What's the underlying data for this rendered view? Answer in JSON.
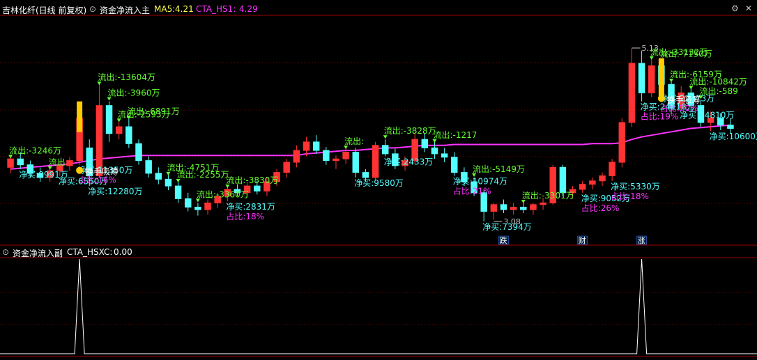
{
  "header": {
    "stock": "吉林化纤(日线 前复权)",
    "indicator": "资金净流入主",
    "ma5_label": "MA5:",
    "ma5_value": "4.21",
    "hs1_label": "CTA_HS1:",
    "hs1_value": "4.29"
  },
  "sub_header": {
    "indicator": "资金净流入副",
    "label": "CTA_HSXC:",
    "value": "0.00"
  },
  "colors": {
    "up": "#ff3333",
    "down": "#54ffff",
    "ma": "#ff33ff",
    "outflow": "#66ff33",
    "inflow": "#54ffff",
    "ratio": "#ff33ff",
    "signal": "#ffcc00",
    "panel_border": "#a00000",
    "header_yellow": "#ffff54"
  },
  "chart_data": [
    {
      "type": "candlestick",
      "title": "资金净流入主",
      "ylim": [
        2.9,
        5.5
      ],
      "price_marks": [
        {
          "label": "5.13",
          "index": 63,
          "value": 5.13
        },
        {
          "label": "3.08",
          "index": 49,
          "value": 3.08
        }
      ],
      "candles": [
        [
          3.72,
          3.85,
          3.65,
          3.82
        ],
        [
          3.82,
          3.9,
          3.7,
          3.75
        ],
        [
          3.75,
          3.8,
          3.6,
          3.65
        ],
        [
          3.65,
          3.72,
          3.55,
          3.6
        ],
        [
          3.6,
          3.7,
          3.55,
          3.68
        ],
        [
          3.68,
          3.78,
          3.62,
          3.74
        ],
        [
          3.74,
          3.84,
          3.68,
          3.8
        ],
        [
          3.8,
          4.45,
          3.75,
          4.3
        ],
        [
          3.95,
          4.05,
          3.5,
          3.62
        ],
        [
          3.62,
          4.7,
          3.6,
          4.45
        ],
        [
          4.45,
          4.5,
          4.02,
          4.12
        ],
        [
          4.12,
          4.28,
          4.05,
          4.2
        ],
        [
          4.2,
          4.3,
          3.95,
          4.0
        ],
        [
          4.0,
          4.05,
          3.75,
          3.8
        ],
        [
          3.8,
          3.85,
          3.6,
          3.65
        ],
        [
          3.65,
          3.72,
          3.52,
          3.58
        ],
        [
          3.58,
          3.65,
          3.45,
          3.5
        ],
        [
          3.5,
          3.55,
          3.3,
          3.35
        ],
        [
          3.35,
          3.42,
          3.2,
          3.25
        ],
        [
          3.25,
          3.3,
          3.15,
          3.22
        ],
        [
          3.22,
          3.34,
          3.16,
          3.3
        ],
        [
          3.3,
          3.42,
          3.24,
          3.38
        ],
        [
          3.38,
          3.5,
          3.32,
          3.46
        ],
        [
          3.46,
          3.52,
          3.38,
          3.42
        ],
        [
          3.42,
          3.55,
          3.36,
          3.5
        ],
        [
          3.5,
          3.56,
          3.4,
          3.44
        ],
        [
          3.44,
          3.6,
          3.38,
          3.55
        ],
        [
          3.55,
          3.7,
          3.5,
          3.66
        ],
        [
          3.66,
          3.82,
          3.6,
          3.78
        ],
        [
          3.78,
          3.98,
          3.72,
          3.92
        ],
        [
          3.92,
          4.08,
          3.85,
          4.02
        ],
        [
          4.02,
          4.1,
          3.88,
          3.92
        ],
        [
          3.92,
          3.96,
          3.75,
          3.8
        ],
        [
          3.8,
          3.86,
          3.7,
          3.82
        ],
        [
          3.82,
          3.96,
          3.76,
          3.9
        ],
        [
          3.9,
          3.95,
          3.6,
          3.66
        ],
        [
          3.66,
          3.7,
          3.55,
          3.6
        ],
        [
          3.6,
          4.02,
          3.56,
          3.98
        ],
        [
          3.98,
          4.05,
          3.85,
          3.88
        ],
        [
          3.88,
          3.94,
          3.7,
          3.74
        ],
        [
          3.74,
          3.85,
          3.68,
          3.8
        ],
        [
          3.8,
          4.12,
          3.76,
          4.05
        ],
        [
          4.05,
          4.12,
          3.9,
          3.95
        ],
        [
          3.95,
          4.02,
          3.82,
          3.88
        ],
        [
          3.88,
          3.95,
          3.78,
          3.84
        ],
        [
          3.84,
          3.9,
          3.62,
          3.66
        ],
        [
          3.66,
          3.72,
          3.5,
          3.55
        ],
        [
          3.55,
          3.6,
          3.38,
          3.42
        ],
        [
          3.42,
          3.46,
          3.08,
          3.2
        ],
        [
          3.2,
          3.3,
          3.1,
          3.28
        ],
        [
          3.28,
          3.34,
          3.18,
          3.22
        ],
        [
          3.22,
          3.3,
          3.16,
          3.25
        ],
        [
          3.25,
          3.32,
          3.18,
          3.22
        ],
        [
          3.22,
          3.3,
          3.16,
          3.28
        ],
        [
          3.28,
          3.36,
          3.22,
          3.3
        ],
        [
          3.3,
          3.75,
          3.28,
          3.72
        ],
        [
          3.72,
          3.75,
          3.38,
          3.42
        ],
        [
          3.42,
          3.5,
          3.36,
          3.46
        ],
        [
          3.46,
          3.56,
          3.42,
          3.52
        ],
        [
          3.52,
          3.6,
          3.46,
          3.56
        ],
        [
          3.56,
          3.66,
          3.5,
          3.62
        ],
        [
          3.62,
          3.82,
          3.56,
          3.78
        ],
        [
          3.78,
          4.3,
          3.72,
          4.25
        ],
        [
          4.25,
          5.13,
          4.2,
          4.95
        ],
        [
          4.95,
          5.1,
          4.5,
          4.6
        ],
        [
          4.6,
          5.0,
          4.55,
          4.92
        ],
        [
          4.92,
          4.96,
          4.6,
          4.7
        ],
        [
          4.7,
          4.75,
          4.35,
          4.42
        ],
        [
          4.42,
          4.68,
          4.4,
          4.6
        ],
        [
          4.6,
          4.65,
          4.38,
          4.45
        ],
        [
          4.45,
          4.52,
          4.2,
          4.25
        ],
        [
          4.25,
          4.38,
          4.15,
          4.3
        ],
        [
          4.3,
          4.36,
          4.16,
          4.22
        ],
        [
          4.22,
          4.3,
          4.12,
          4.18
        ]
      ],
      "ma": [
        3.7,
        3.71,
        3.72,
        3.73,
        3.74,
        3.75,
        3.76,
        3.78,
        3.8,
        3.82,
        3.83,
        3.84,
        3.85,
        3.86,
        3.86,
        3.86,
        3.86,
        3.86,
        3.86,
        3.86,
        3.86,
        3.86,
        3.86,
        3.86,
        3.86,
        3.86,
        3.86,
        3.86,
        3.86,
        3.86,
        3.88,
        3.89,
        3.9,
        3.91,
        3.92,
        3.92,
        3.93,
        3.94,
        3.95,
        3.95,
        3.96,
        3.97,
        3.98,
        3.98,
        3.98,
        3.99,
        3.99,
        3.99,
        3.99,
        3.99,
        3.99,
        3.99,
        3.99,
        3.99,
        3.99,
        3.99,
        3.99,
        3.99,
        3.99,
        4.0,
        4.0,
        4.0,
        4.01,
        4.05,
        4.08,
        4.1,
        4.12,
        4.14,
        4.16,
        4.18,
        4.19,
        4.2,
        4.21,
        4.22
      ],
      "annotations": [
        {
          "type": "outflow",
          "index": 0,
          "text": "流出:-3246万"
        },
        {
          "type": "outflow",
          "index": 4,
          "text": "流出"
        },
        {
          "type": "inflow",
          "index": 1,
          "text": "净买:9991万"
        },
        {
          "type": "inflow",
          "index": 5,
          "text": "净买:6550万"
        },
        {
          "type": "outflow",
          "index": 9,
          "text": "流出:-13604万"
        },
        {
          "type": "outflow",
          "index": 10,
          "text": "流出:-3960万"
        },
        {
          "type": "outflow",
          "index": 11,
          "text": "流出:-2593万"
        },
        {
          "type": "outflow",
          "index": 12,
          "text": "流出:-6891万"
        },
        {
          "type": "inflow",
          "index": 7,
          "text": "净买:11350万"
        },
        {
          "type": "inflow",
          "index": 8,
          "text": "净买:12280万"
        },
        {
          "type": "ratio",
          "index": 7,
          "text": "占比:16%"
        },
        {
          "type": "signal",
          "index": 7,
          "text": "换手吸筹"
        },
        {
          "type": "outflow",
          "index": 16,
          "text": "流出:-4751万"
        },
        {
          "type": "outflow",
          "index": 17,
          "text": "流出:-2255万"
        },
        {
          "type": "outflow",
          "index": 19,
          "text": "流出:-3360万"
        },
        {
          "type": "outflow",
          "index": 22,
          "text": "流出:-3830万"
        },
        {
          "type": "inflow",
          "index": 22,
          "text": "净买:2831万"
        },
        {
          "type": "ratio",
          "index": 22,
          "text": "占比:18%"
        },
        {
          "type": "outflow",
          "index": 34,
          "text": "流出:"
        },
        {
          "type": "inflow",
          "index": 35,
          "text": "净买:9580万"
        },
        {
          "type": "outflow",
          "index": 38,
          "text": "流出:-3828万"
        },
        {
          "type": "inflow",
          "index": 38,
          "text": "净买:2433万"
        },
        {
          "type": "outflow",
          "index": 43,
          "text": "流出:-1217"
        },
        {
          "type": "outflow",
          "index": 47,
          "text": "流出:-5149万"
        },
        {
          "type": "inflow",
          "index": 48,
          "text": "净买:7394万"
        },
        {
          "type": "inflow",
          "index": 45,
          "text": "净买:10974万"
        },
        {
          "type": "ratio",
          "index": 45,
          "text": "占比:21%"
        },
        {
          "type": "outflow",
          "index": 52,
          "text": "流出:-3301万"
        },
        {
          "type": "inflow",
          "index": 58,
          "text": "净买:9052万"
        },
        {
          "type": "ratio",
          "index": 58,
          "text": "占比:26%"
        },
        {
          "type": "inflow",
          "index": 61,
          "text": "净买:5330万"
        },
        {
          "type": "ratio",
          "index": 61,
          "text": "占比:18%"
        },
        {
          "type": "inflow",
          "index": 64,
          "text": "净买:24118万"
        },
        {
          "type": "ratio",
          "index": 64,
          "text": "占比:19%"
        },
        {
          "type": "outflow",
          "index": 65,
          "text": "流出:-33132万"
        },
        {
          "type": "outflow",
          "index": 66,
          "text": "流出:-7150万"
        },
        {
          "type": "outflow",
          "index": 67,
          "text": "流出:-6159万"
        },
        {
          "type": "outflow",
          "index": 69,
          "text": "流出:-10842万"
        },
        {
          "type": "outflow",
          "index": 70,
          "text": "流出:-589"
        },
        {
          "type": "inflow",
          "index": 68,
          "text": "净买:24810万"
        },
        {
          "type": "inflow",
          "index": 66,
          "text": "净买:22073万"
        },
        {
          "type": "inflow",
          "index": 71,
          "text": "净买:10600万"
        },
        {
          "type": "ratio",
          "index": 66,
          "text": "占比:20%"
        },
        {
          "type": "signal",
          "index": 66,
          "text": "换手吸筹"
        }
      ],
      "event_labels": [
        {
          "text": "跌",
          "index": 50
        },
        {
          "text": "财",
          "index": 58
        },
        {
          "text": "涨",
          "index": 64
        }
      ]
    },
    {
      "type": "line",
      "title": "资金净流入副",
      "series": [
        {
          "name": "CTA_HSXC",
          "spikes": [
            7,
            64
          ],
          "peak": 1,
          "values": "0 except spikes"
        }
      ],
      "ylim": [
        0,
        1
      ]
    }
  ]
}
